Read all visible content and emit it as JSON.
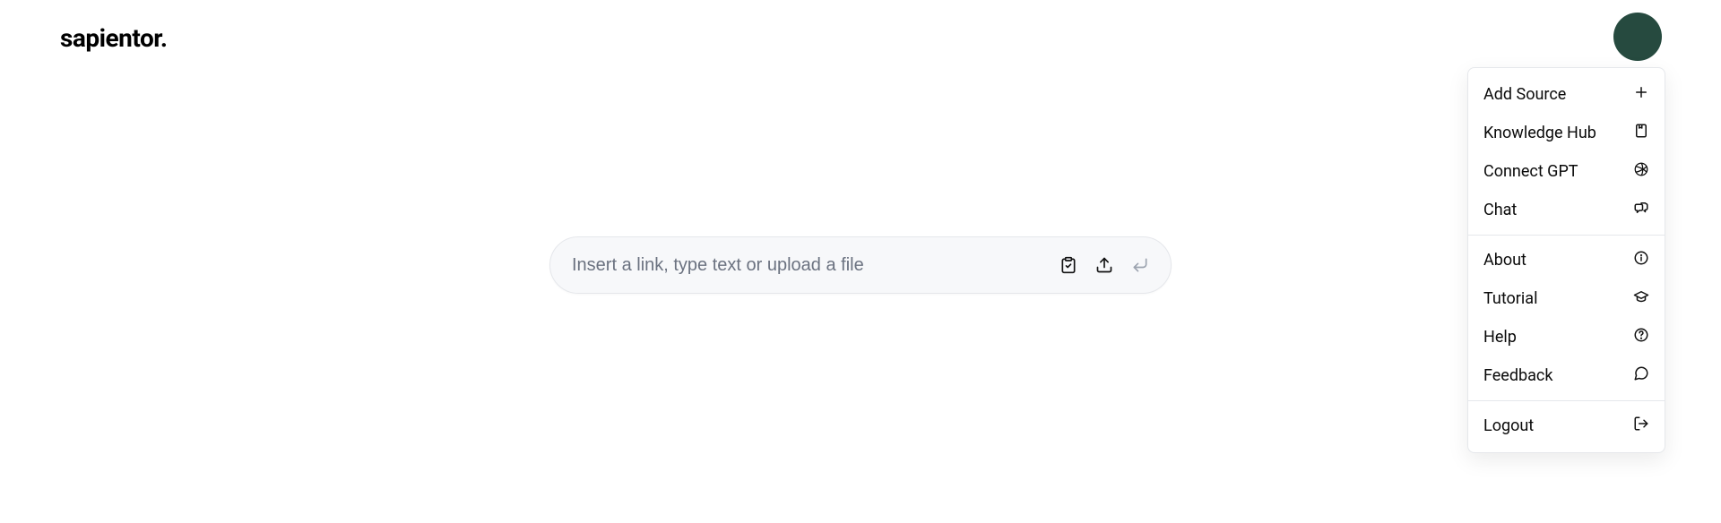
{
  "brand": "sapientor.",
  "input": {
    "placeholder": "Insert a link, type text or upload a file",
    "value": ""
  },
  "menu": {
    "group1": [
      {
        "label": "Add Source",
        "icon": "plus-icon"
      },
      {
        "label": "Knowledge Hub",
        "icon": "book-icon"
      },
      {
        "label": "Connect GPT",
        "icon": "openai-icon"
      },
      {
        "label": "Chat",
        "icon": "chats-icon"
      }
    ],
    "group2": [
      {
        "label": "About",
        "icon": "info-icon"
      },
      {
        "label": "Tutorial",
        "icon": "grad-cap-icon"
      },
      {
        "label": "Help",
        "icon": "help-icon"
      },
      {
        "label": "Feedback",
        "icon": "chat-bubble-icon"
      }
    ],
    "group3": [
      {
        "label": "Logout",
        "icon": "logout-icon"
      }
    ]
  },
  "colors": {
    "avatar": "#264a3f"
  }
}
